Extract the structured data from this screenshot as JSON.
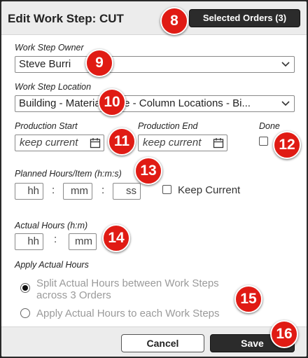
{
  "dialog": {
    "title": "Edit Work Step: CUT",
    "selected_orders_label": "Selected Orders (3)"
  },
  "owner": {
    "label": "Work Step Owner",
    "value": "Steve Burri"
  },
  "location": {
    "label": "Work Step Location",
    "value": "Building - Material Zone - Column Locations - Bi..."
  },
  "production_start": {
    "label": "Production Start",
    "placeholder": "keep current"
  },
  "production_end": {
    "label": "Production End",
    "placeholder": "keep current"
  },
  "done": {
    "label": "Done",
    "checked": false
  },
  "planned_hours": {
    "label": "Planned Hours/Item (h:m:s)",
    "hh": "hh",
    "mm": "mm",
    "ss": "ss",
    "sep": ":",
    "keep_current_label": "Keep Current"
  },
  "actual_hours": {
    "label": "Actual Hours (h:m)",
    "hh": "hh",
    "mm": "mm",
    "sep": ":"
  },
  "apply": {
    "label": "Apply Actual Hours",
    "option1": "Split Actual Hours between Work Steps across 3 Orders",
    "option2": "Apply Actual Hours to each Work Steps",
    "selected": 1
  },
  "footer": {
    "cancel_label": "Cancel",
    "save_label": "Save"
  },
  "annotations": {
    "b8": "8",
    "b9": "9",
    "b10": "10",
    "b11": "11",
    "b12": "12",
    "b13": "13",
    "b14": "14",
    "b15": "15",
    "b16": "16"
  },
  "colors": {
    "badge": "#e01b14",
    "dark_button": "#2b2b2b",
    "header_bg": "#ececec"
  }
}
